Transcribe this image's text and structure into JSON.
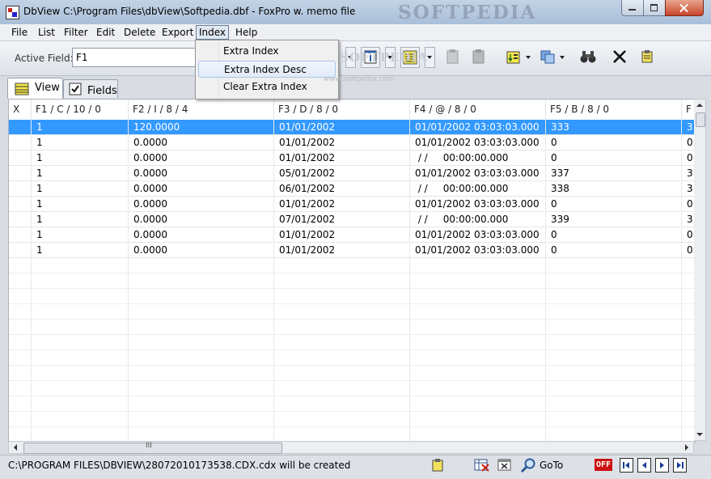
{
  "window": {
    "title": "DbView C:\\Program Files\\dbView\\Softpedia.dbf  -  FoxPro w. memo file",
    "watermark": "SOFTPEDIA"
  },
  "menu": [
    "File",
    "List",
    "Filter",
    "Edit",
    "Delete",
    "Export",
    "Index",
    "Help"
  ],
  "toolbar": {
    "active_field_label": "Active Field:",
    "active_field_value": "F1"
  },
  "tabs": [
    {
      "label": "View",
      "active": true
    },
    {
      "label": "Fields",
      "active": false
    }
  ],
  "index_menu": {
    "items": [
      "Extra Index",
      "Extra Index Desc",
      "Clear Extra Index"
    ],
    "highlighted": "Extra Index Desc"
  },
  "watermark_overlay": {
    "text": "SOFTPEDIA",
    "url": "www.softpedia.com"
  },
  "grid": {
    "columns": [
      "X",
      "F1 / C / 10 / 0",
      "F2 / I / 8 / 4",
      "F3 / D / 8 / 0",
      "F4 / @ / 8 / 0",
      "F5 / B / 8 / 0",
      "F"
    ],
    "selected_row": 0,
    "rows": [
      [
        "",
        "1",
        "120.0000",
        "01/01/2002",
        "01/01/2002 03:03:03.000",
        "333",
        "3"
      ],
      [
        "",
        "1",
        "0.0000",
        "01/01/2002",
        "01/01/2002 03:03:03.000",
        "0",
        "0"
      ],
      [
        "",
        "1",
        "0.0000",
        "01/01/2002",
        " / /     00:00:00.000",
        "0",
        "0"
      ],
      [
        "",
        "1",
        "0.0000",
        "05/01/2002",
        "01/01/2002 03:03:03.000",
        "337",
        "3"
      ],
      [
        "",
        "1",
        "0.0000",
        "06/01/2002",
        " / /     00:00:00.000",
        "338",
        "3"
      ],
      [
        "",
        "1",
        "0.0000",
        "01/01/2002",
        "01/01/2002 03:03:03.000",
        "0",
        "0"
      ],
      [
        "",
        "1",
        "0.0000",
        "07/01/2002",
        " / /     00:00:00.000",
        "339",
        "3"
      ],
      [
        "",
        "1",
        "0.0000",
        "01/01/2002",
        "01/01/2002 03:03:03.000",
        "0",
        "0"
      ],
      [
        "",
        "1",
        "0.0000",
        "01/01/2002",
        "01/01/2002 03:03:03.000",
        "0",
        "0"
      ]
    ]
  },
  "hscroll_grip": "III",
  "status": {
    "text": "C:\\PROGRAM FILES\\DBVIEW\\28072010173538.CDX.cdx will be created",
    "goto_label": "GoTo",
    "off_badge": "OFF"
  },
  "colors": {
    "selection": "#3399ff",
    "off_badge": "#cc1111"
  }
}
